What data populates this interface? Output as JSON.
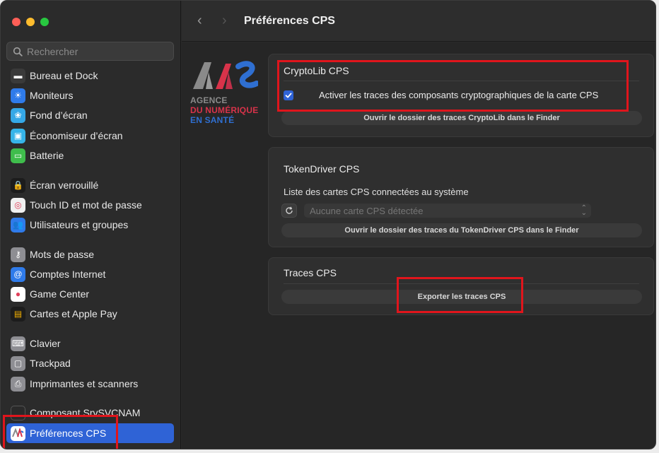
{
  "window": {
    "title": "Préférences CPS"
  },
  "search": {
    "placeholder": "Rechercher"
  },
  "sidebar": {
    "items": [
      {
        "label": "Bureau et Dock",
        "icon": "dock-icon",
        "color": "#3a3a3a"
      },
      {
        "label": "Moniteurs",
        "icon": "sun-icon",
        "color": "#2f7bea"
      },
      {
        "label": "Fond d’écran",
        "icon": "flower-icon",
        "color": "#35a8e6"
      },
      {
        "label": "Économiseur d’écran",
        "icon": "screensaver-icon",
        "color": "#36b4e8"
      },
      {
        "label": "Batterie",
        "icon": "battery-icon",
        "color": "#3fbd4c"
      },
      {
        "label": "Écran verrouillé",
        "icon": "lock-screen-icon",
        "color": "#1c1c1c"
      },
      {
        "label": "Touch ID et mot de passe",
        "icon": "fingerprint-icon",
        "color": "#f0f0f0"
      },
      {
        "label": "Utilisateurs et groupes",
        "icon": "users-icon",
        "color": "#2f7bea"
      },
      {
        "label": "Mots de passe",
        "icon": "key-icon",
        "color": "#8e8e93"
      },
      {
        "label": "Comptes Internet",
        "icon": "at-icon",
        "color": "#2f7bea"
      },
      {
        "label": "Game Center",
        "icon": "game-center-icon",
        "color": "#ffffff"
      },
      {
        "label": "Cartes et Apple Pay",
        "icon": "wallet-icon",
        "color": "#1c1c1c"
      },
      {
        "label": "Clavier",
        "icon": "keyboard-icon",
        "color": "#8e8e93"
      },
      {
        "label": "Trackpad",
        "icon": "trackpad-icon",
        "color": "#8e8e93"
      },
      {
        "label": "Imprimantes et scanners",
        "icon": "printer-icon",
        "color": "#8e8e93"
      },
      {
        "label": "Composant SrvSVCNAM",
        "icon": "component-icon",
        "color": "#2a2a2a"
      },
      {
        "label": "Préférences CPS",
        "icon": "cps-icon",
        "color": "#ffffff"
      }
    ]
  },
  "logo": {
    "line1": "AGENCE",
    "line2": "DU NUMÉRIQUE",
    "line3": "EN SANTÉ"
  },
  "cryptolib": {
    "title": "CryptoLib CPS",
    "checkbox_label": "Activer les traces des composants cryptographiques de la carte CPS",
    "open_folder_button": "Ouvrir le dossier des traces CryptoLib dans le Finder"
  },
  "tokendriver": {
    "title": "TokenDriver CPS",
    "list_label": "Liste des cartes CPS connectées au système",
    "select_value": "Aucune carte CPS détectée",
    "open_folder_button": "Ouvrir le dossier des traces du TokenDriver CPS dans le Finder"
  },
  "traces": {
    "title": "Traces CPS",
    "export_button": "Exporter les traces CPS"
  },
  "colors": {
    "accent": "#2f63d6",
    "highlight": "#e0151c",
    "logo_grey": "#8a8a8a",
    "logo_red": "#d8334a",
    "logo_blue": "#2f6fd1"
  }
}
